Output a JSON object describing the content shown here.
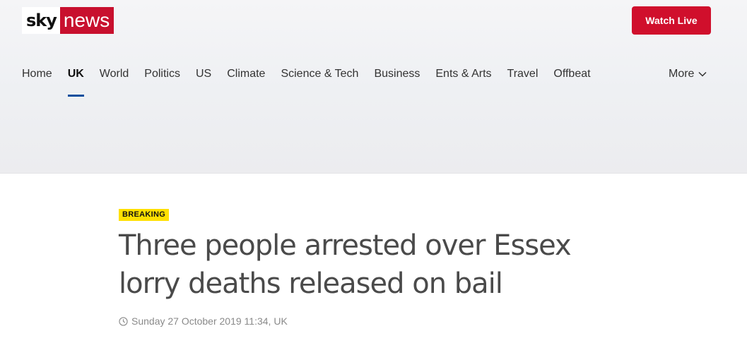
{
  "brand": {
    "logo_sky": "sky",
    "logo_news": "news",
    "accent_color": "#c8102e"
  },
  "header": {
    "watch_live_label": "Watch Live"
  },
  "nav": {
    "items": [
      {
        "label": "Home",
        "active": false
      },
      {
        "label": "UK",
        "active": true
      },
      {
        "label": "World",
        "active": false
      },
      {
        "label": "Politics",
        "active": false
      },
      {
        "label": "US",
        "active": false
      },
      {
        "label": "Climate",
        "active": false
      },
      {
        "label": "Science & Tech",
        "active": false
      },
      {
        "label": "Business",
        "active": false
      },
      {
        "label": "Ents & Arts",
        "active": false
      },
      {
        "label": "Travel",
        "active": false
      },
      {
        "label": "Offbeat",
        "active": false
      }
    ],
    "more_label": "More",
    "more_icon": "chevron-down-icon"
  },
  "article": {
    "badge": "BREAKING",
    "badge_color": "#ffe000",
    "headline": "Three people arrested over Essex lorry deaths released on bail",
    "timestamp_icon": "clock-icon",
    "timestamp": "Sunday 27 October 2019 11:34, UK"
  }
}
